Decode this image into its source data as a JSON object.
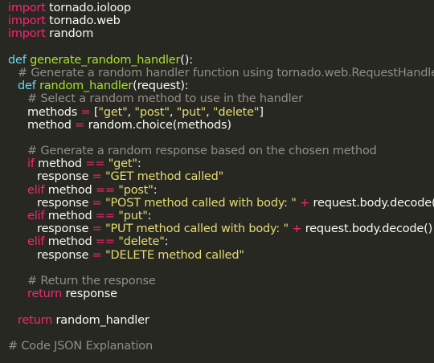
{
  "editor": {
    "colors": {
      "background": "#272822",
      "keyword": "#f92672",
      "def_keyword": "#66d9ef",
      "function": "#a6e22e",
      "string": "#e6db74",
      "comment": "#908f86",
      "text": "#f8f8f2"
    },
    "lines": {
      "l1": {
        "kw": "import",
        "rest": " tornado.ioloop"
      },
      "l2": {
        "kw": "import",
        "rest": " tornado.web"
      },
      "l3": {
        "kw": "import",
        "rest": " random"
      },
      "l5": {
        "kw": "def",
        "fn": "generate_random_handler",
        "rest": "():"
      },
      "l6": {
        "comment": "# Generate a random handler function using tornado.web.RequestHandler"
      },
      "l7": {
        "kw": "def",
        "fn": "random_handler",
        "rest": "(request):"
      },
      "l8": {
        "comment": "# Select a random method to use in the handler"
      },
      "l9": {
        "a": "methods ",
        "op": "=",
        "b": " [",
        "s1": "\"get\"",
        "c1": ", ",
        "s2": "\"post\"",
        "c2": ", ",
        "s3": "\"put\"",
        "c3": ", ",
        "s4": "\"delete\"",
        "end": "]"
      },
      "l10": {
        "a": "method ",
        "op": "=",
        "b": " random.choice(methods)"
      },
      "l12": {
        "comment": "# Generate a random response based on the chosen method"
      },
      "l13": {
        "kw": "if",
        "a": " method ",
        "op": "==",
        "b": " ",
        "s": "\"get\"",
        "end": ":"
      },
      "l14": {
        "a": "response ",
        "op": "=",
        "b": " ",
        "s": "\"GET method called\""
      },
      "l15": {
        "kw": "elif",
        "a": " method ",
        "op": "==",
        "b": " ",
        "s": "\"post\"",
        "end": ":"
      },
      "l16": {
        "a": "response ",
        "op": "=",
        "b": " ",
        "s": "\"POST method called with body: \"",
        "c": " ",
        "op2": "+",
        "end": " request.body.decode()"
      },
      "l17": {
        "kw": "elif",
        "a": " method ",
        "op": "==",
        "b": " ",
        "s": "\"put\"",
        "end": ":"
      },
      "l18": {
        "a": "response ",
        "op": "=",
        "b": " ",
        "s": "\"PUT method called with body: \"",
        "c": " ",
        "op2": "+",
        "end": " request.body.decode()"
      },
      "l19": {
        "kw": "elif",
        "a": " method ",
        "op": "==",
        "b": " ",
        "s": "\"delete\"",
        "end": ":"
      },
      "l20": {
        "a": "response ",
        "op": "=",
        "b": " ",
        "s": "\"DELETE method called\""
      },
      "l22": {
        "comment": "# Return the response"
      },
      "l23": {
        "kw": "return",
        "rest": " response"
      },
      "l25": {
        "kw": "return",
        "rest": " random_handler"
      },
      "l27": {
        "comment": "# Code JSON Explanation"
      }
    }
  }
}
